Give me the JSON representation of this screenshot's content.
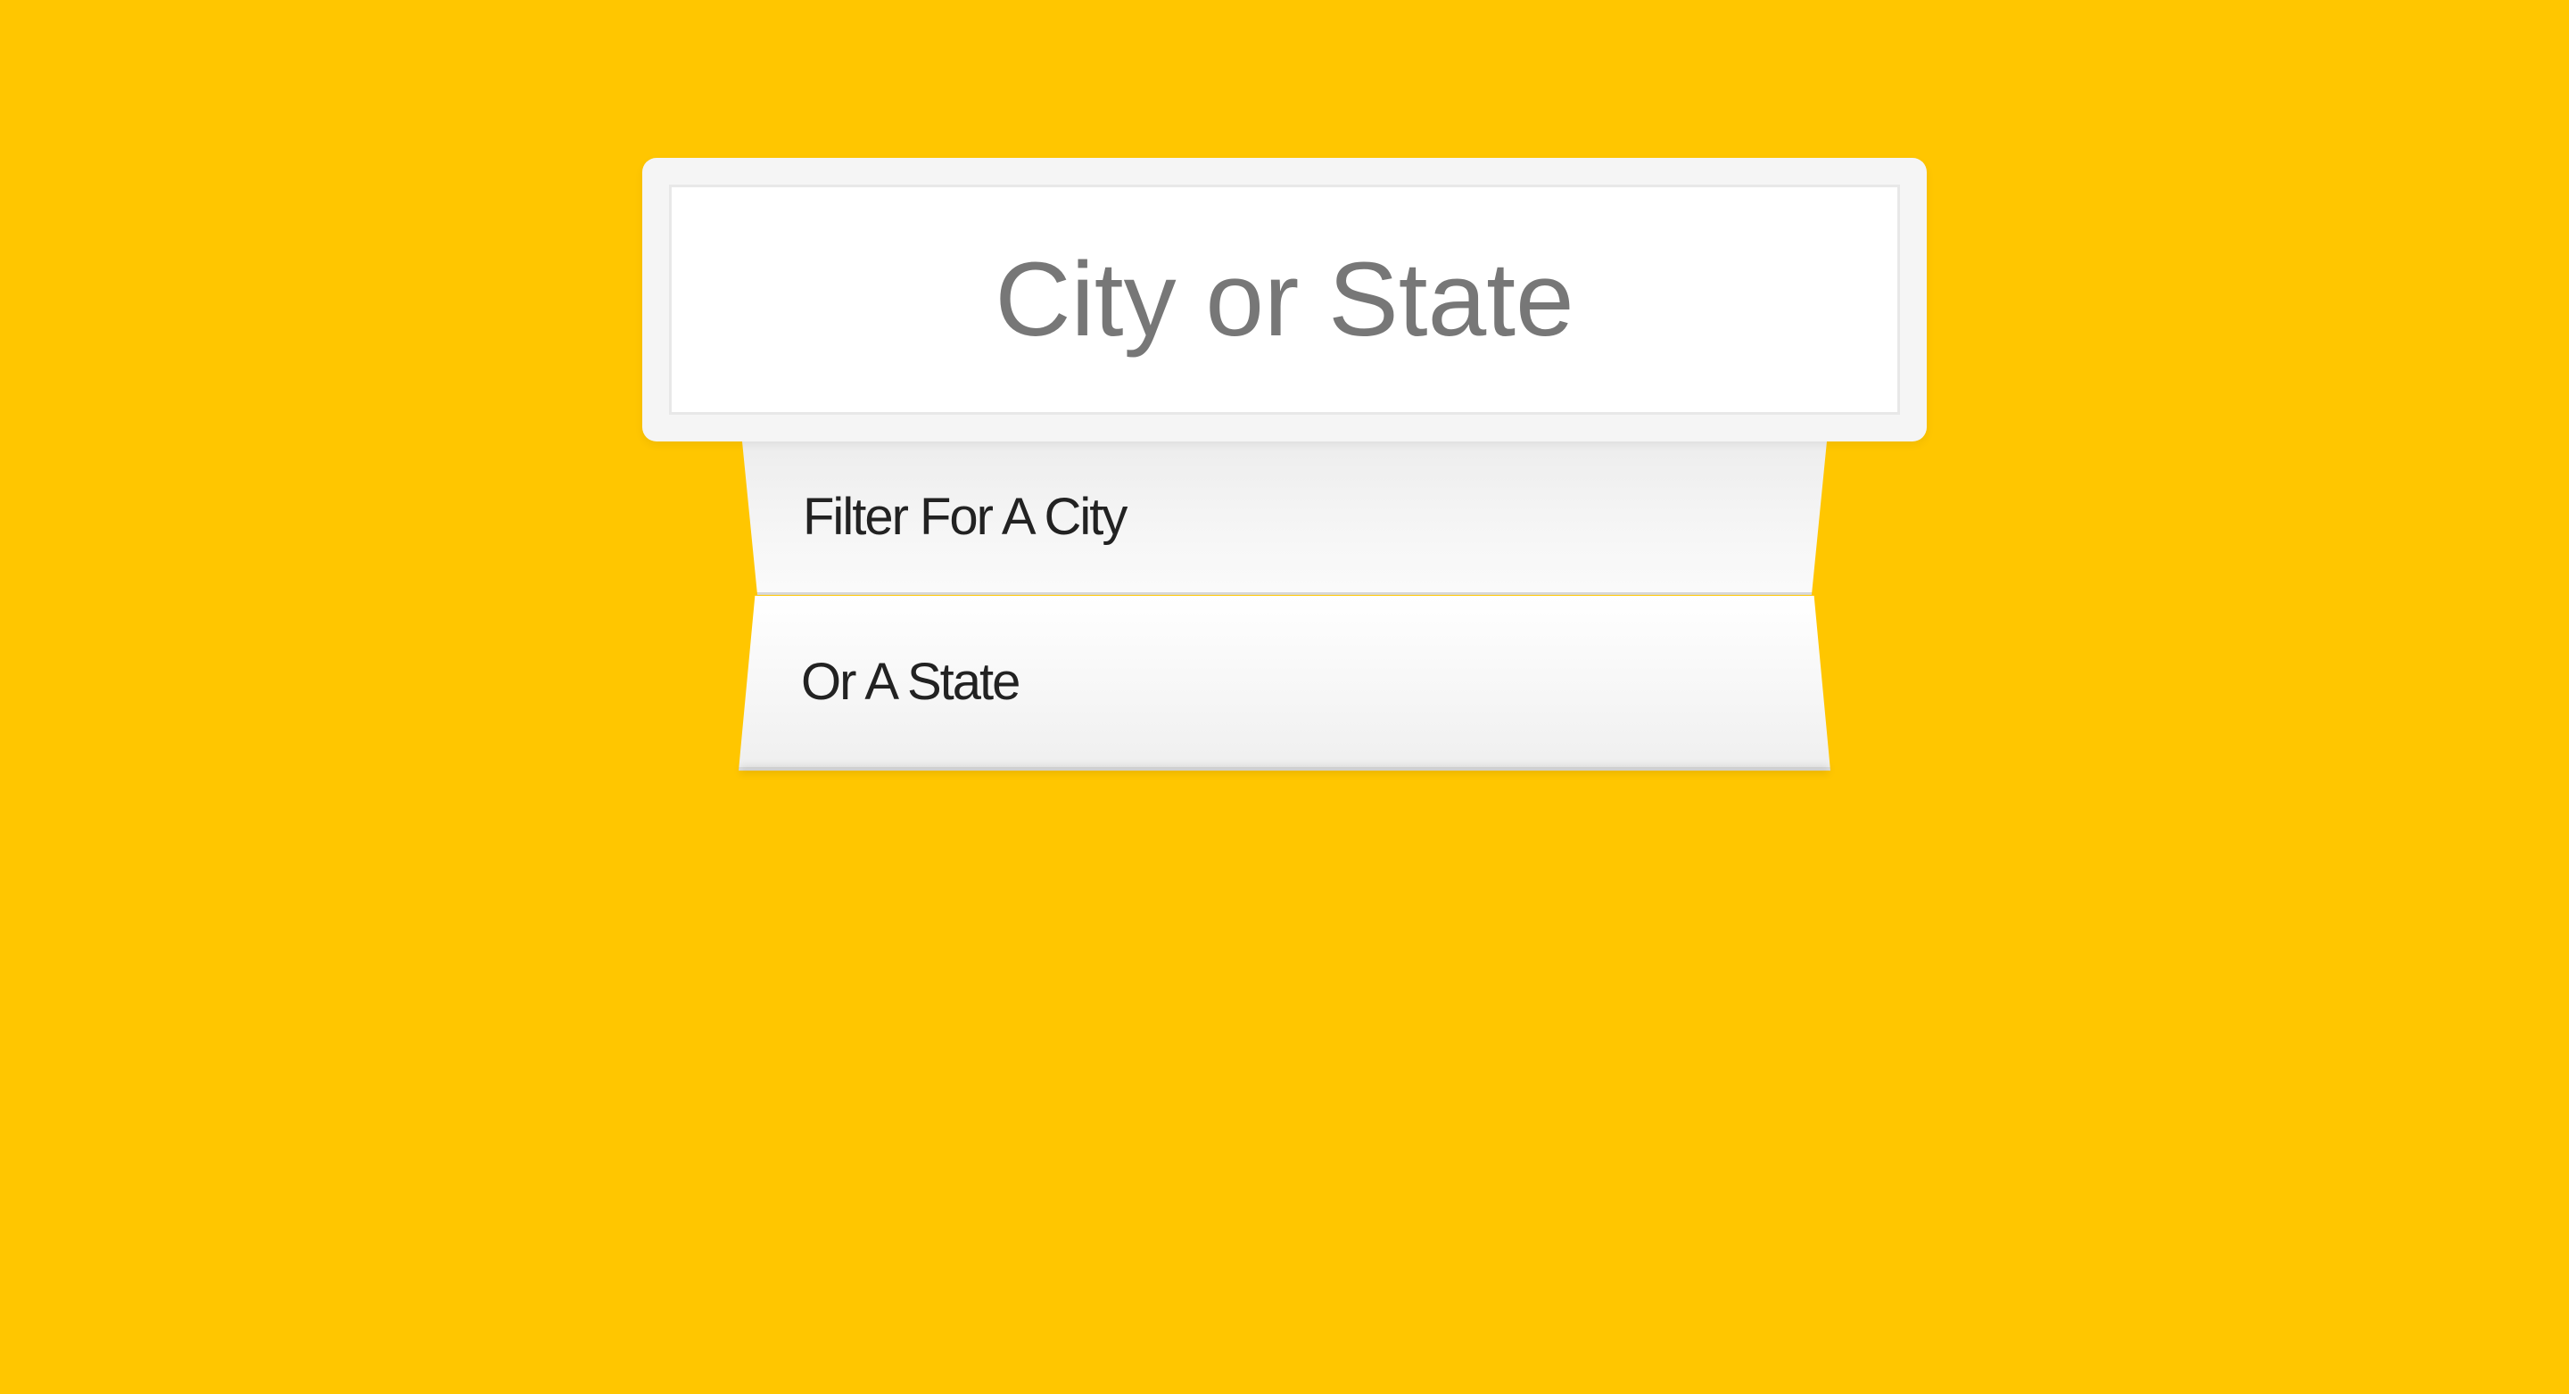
{
  "search": {
    "placeholder": "City or State"
  },
  "suggestions": [
    {
      "label": "Filter For A City"
    },
    {
      "label": "Or A State"
    }
  ],
  "colors": {
    "background": "#FFC600",
    "form_background": "#F5F5F5",
    "input_background": "#FFFFFF",
    "placeholder_text": "#777777",
    "suggestion_text": "#222222"
  }
}
